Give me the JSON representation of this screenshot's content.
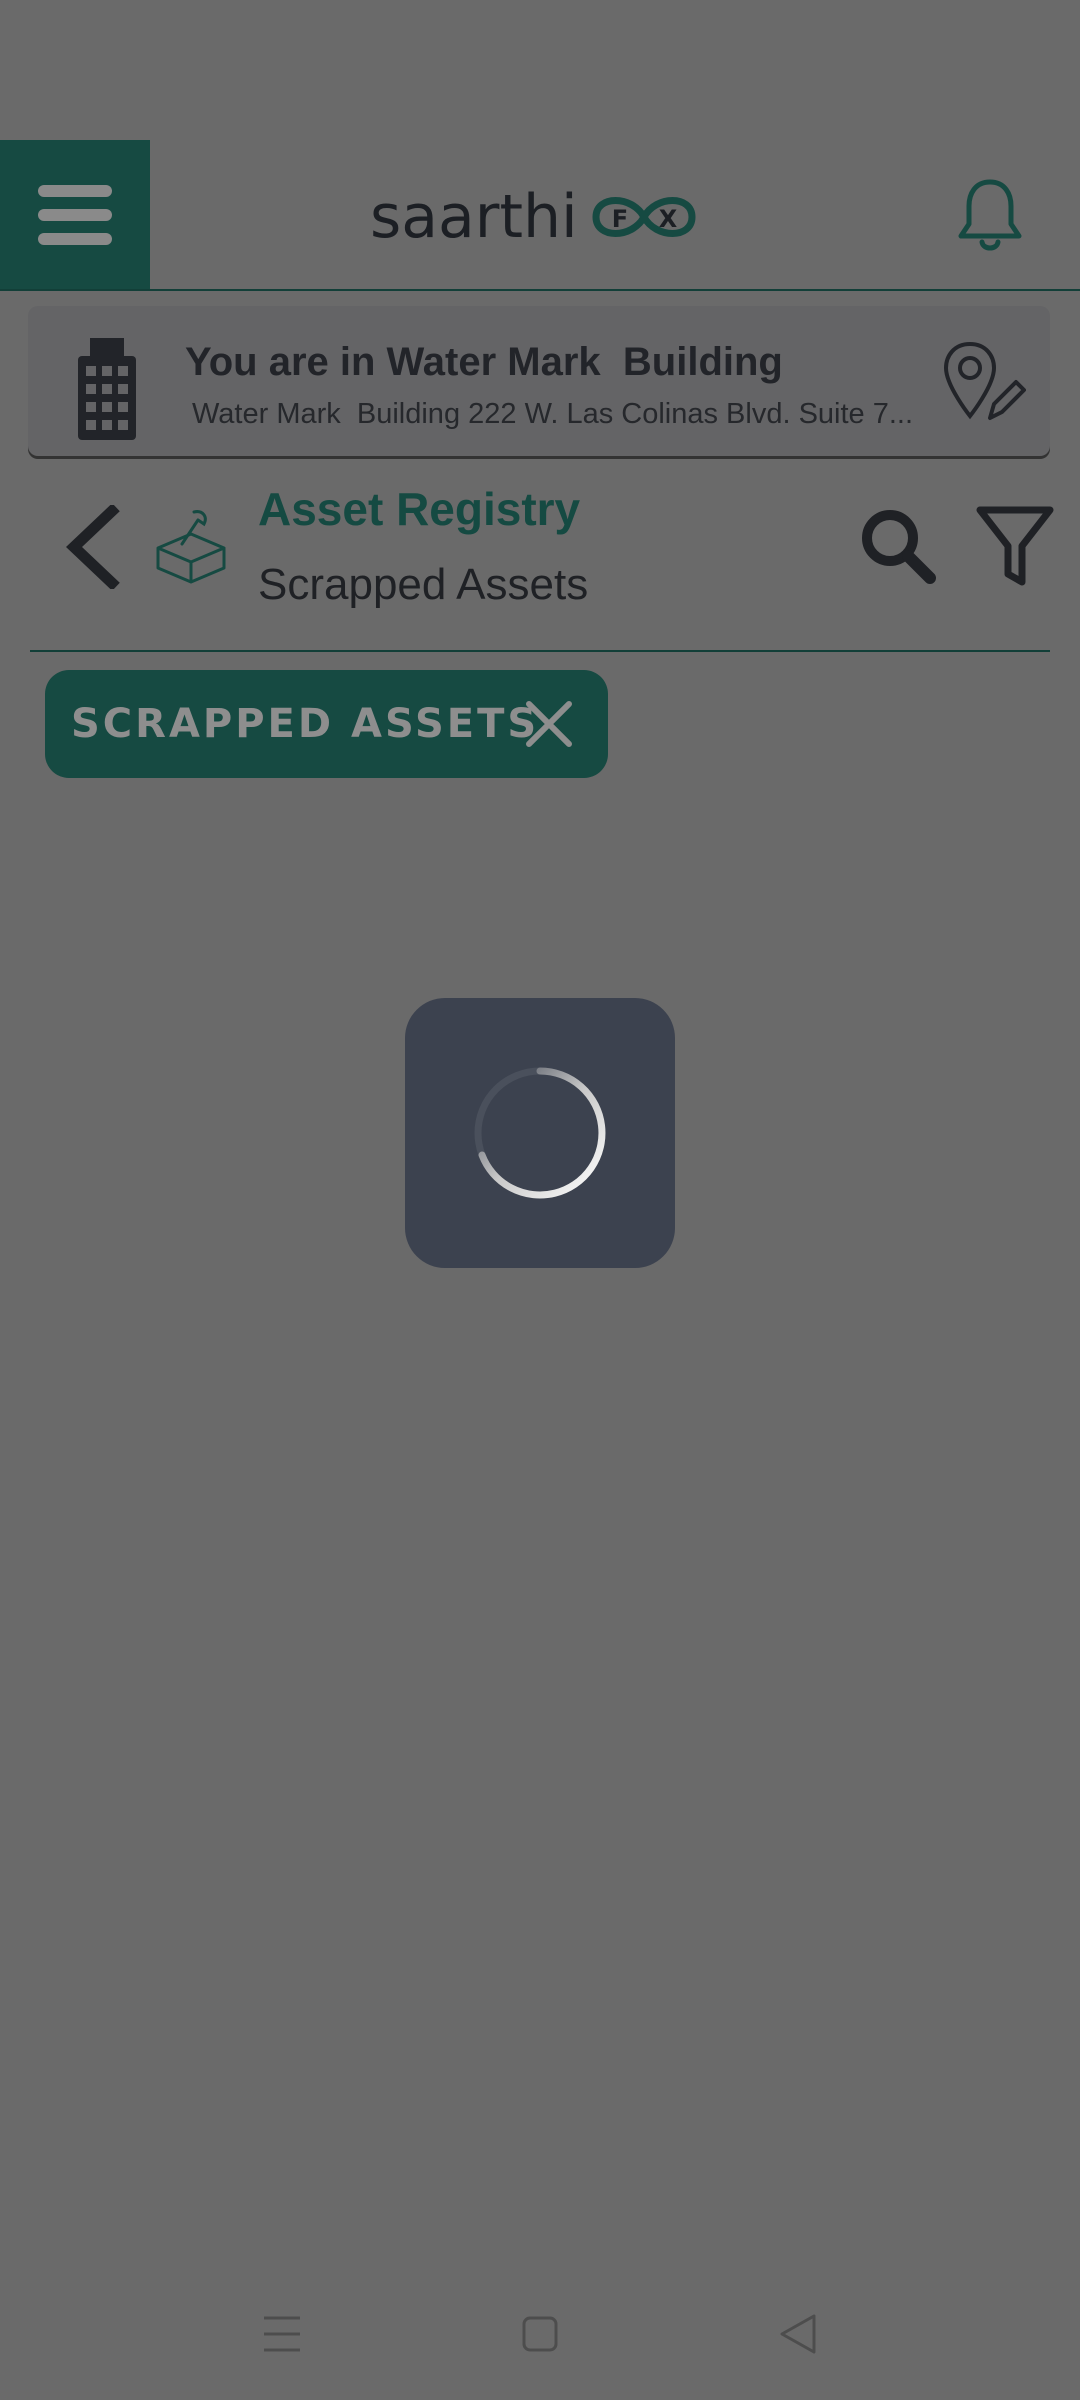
{
  "app": {
    "logo_text": "saarthi",
    "logo_badge_left": "F",
    "logo_badge_right": "X"
  },
  "location": {
    "title": "You are in Water Mark  Building",
    "address": "Water Mark  Building 222 W. Las Colinas Blvd. Suite 7..."
  },
  "page": {
    "title": "Asset Registry",
    "subtitle": "Scrapped Assets"
  },
  "filter_chip": {
    "label": "SCRAPPED ASSETS"
  },
  "colors": {
    "brand": "#164a42",
    "overlay_bg": "#6a6a6a",
    "loader_bg": "#3c424f"
  },
  "icons": {
    "menu": "hamburger-icon",
    "notifications": "bell-icon",
    "building": "building-icon",
    "edit_location": "location-edit-icon",
    "back": "chevron-left-icon",
    "module": "asset-box-icon",
    "search": "search-icon",
    "filter": "filter-icon",
    "chip_close": "close-icon",
    "loading": "spinner-icon",
    "nav_recents": "recents-icon",
    "nav_home": "home-icon",
    "nav_back": "back-triangle-icon"
  }
}
